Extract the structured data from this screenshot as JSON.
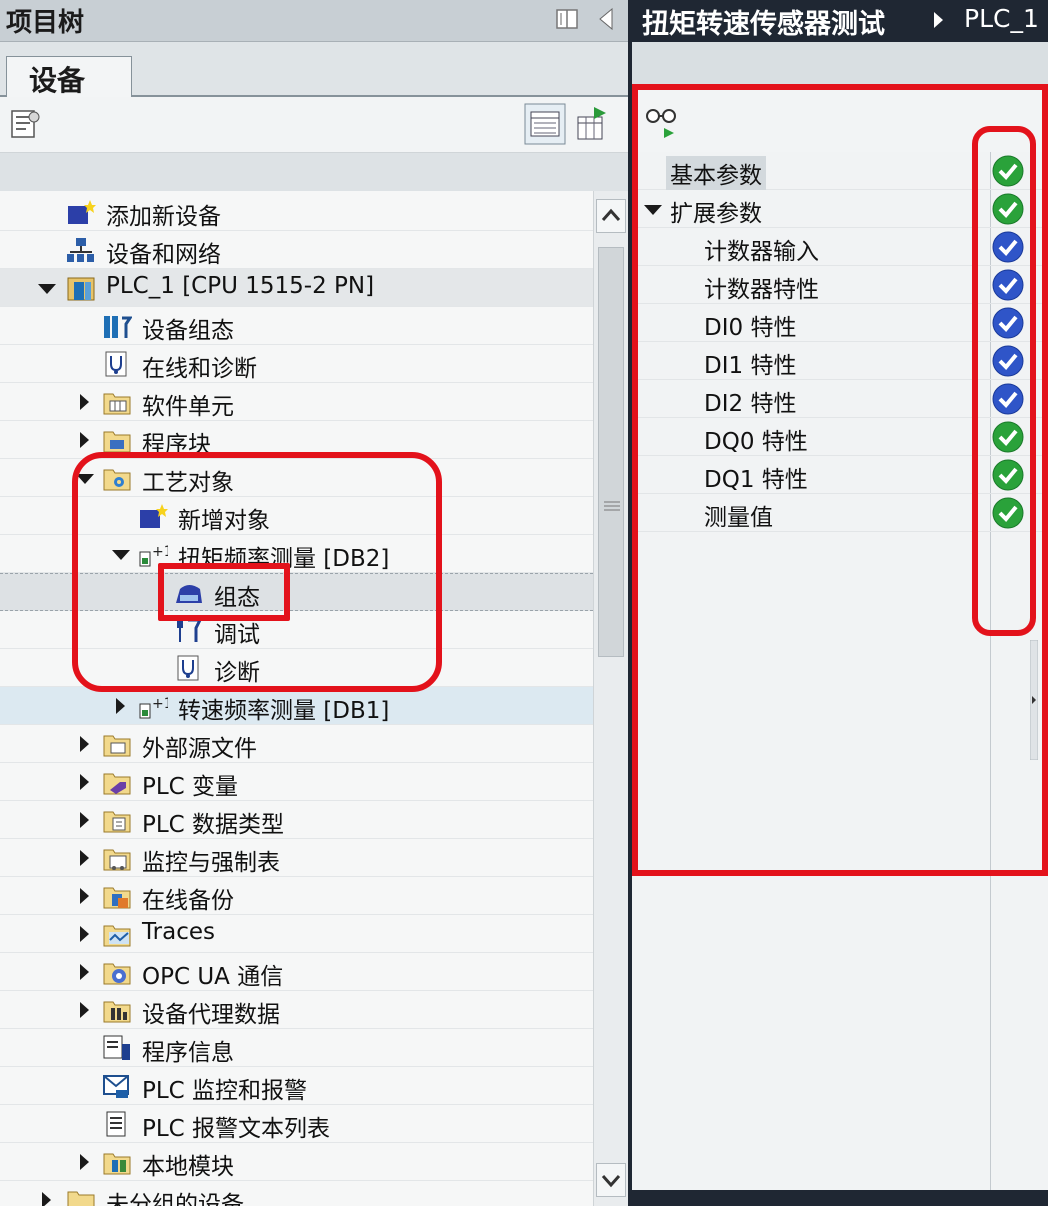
{
  "project_tree": {
    "title": "项目树",
    "tab": "设备",
    "items": [
      {
        "label": "添加新设备",
        "icon": "add-device-icon"
      },
      {
        "label": "设备和网络",
        "icon": "network-icon"
      },
      {
        "label": "PLC_1 [CPU 1515-2 PN]",
        "icon": "plc-icon"
      },
      {
        "label": "设备组态",
        "icon": "device-config-icon"
      },
      {
        "label": "在线和诊断",
        "icon": "diagnostics-icon"
      },
      {
        "label": "软件单元",
        "icon": "folder-icon"
      },
      {
        "label": "程序块",
        "icon": "folder-icon"
      },
      {
        "label": "工艺对象",
        "icon": "folder-gear-icon"
      },
      {
        "label": "新增对象",
        "icon": "add-object-icon"
      },
      {
        "label": "扭矩频率测量 [DB2]",
        "icon": "technology-object-icon"
      },
      {
        "label": "组态",
        "icon": "configuration-icon"
      },
      {
        "label": "调试",
        "icon": "commissioning-icon"
      },
      {
        "label": "诊断",
        "icon": "diagnostics-icon"
      },
      {
        "label": "转速频率测量 [DB1]",
        "icon": "technology-object-icon"
      },
      {
        "label": "外部源文件",
        "icon": "folder-icon"
      },
      {
        "label": "PLC 变量",
        "icon": "folder-icon"
      },
      {
        "label": "PLC 数据类型",
        "icon": "folder-icon"
      },
      {
        "label": "监控与强制表",
        "icon": "folder-icon"
      },
      {
        "label": "在线备份",
        "icon": "folder-icon"
      },
      {
        "label": "Traces",
        "icon": "folder-icon"
      },
      {
        "label": "OPC UA 通信",
        "icon": "folder-icon"
      },
      {
        "label": "设备代理数据",
        "icon": "folder-icon"
      },
      {
        "label": "程序信息",
        "icon": "program-info-icon"
      },
      {
        "label": "PLC 监控和报警",
        "icon": "alarm-icon"
      },
      {
        "label": "PLC 报警文本列表",
        "icon": "text-list-icon"
      },
      {
        "label": "本地模块",
        "icon": "folder-icon"
      },
      {
        "label": "未分组的设备",
        "icon": "folder-icon"
      }
    ]
  },
  "editor": {
    "title": "扭矩转速传感器测试",
    "breadcrumb": "PLC_1",
    "params": [
      {
        "label": "基本参数",
        "status": "ok-green"
      },
      {
        "label": "扩展参数",
        "status": "ok-green"
      },
      {
        "label": "计数器输入",
        "status": "ok-blue"
      },
      {
        "label": "计数器特性",
        "status": "ok-blue"
      },
      {
        "label": "DI0 特性",
        "status": "ok-blue"
      },
      {
        "label": "DI1 特性",
        "status": "ok-blue"
      },
      {
        "label": "DI2 特性",
        "status": "ok-blue"
      },
      {
        "label": "DQ0 特性",
        "status": "ok-green"
      },
      {
        "label": "DQ1 特性",
        "status": "ok-green"
      },
      {
        "label": "测量值",
        "status": "ok-green"
      }
    ]
  },
  "colors": {
    "annotation_red": "#e3121b",
    "check_green": "#2aa23a",
    "check_blue": "#2f55c8",
    "header_dark": "#1f2733"
  }
}
